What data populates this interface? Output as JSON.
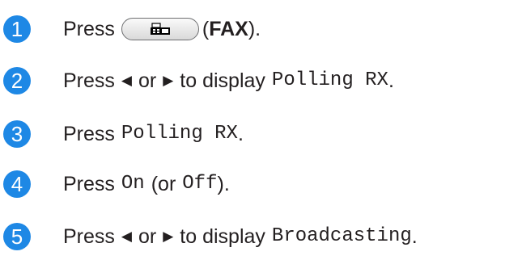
{
  "accent_color": "#1e88e5",
  "steps": [
    {
      "number": "1",
      "press": "Press",
      "open_paren": "(",
      "fax_label": "FAX",
      "close": ")."
    },
    {
      "number": "2",
      "press": "Press",
      "left_arrow": "◀",
      "or": "or",
      "right_arrow": "▶",
      "to_display": "to display",
      "lcd_text": "Polling RX",
      "period": "."
    },
    {
      "number": "3",
      "press": "Press",
      "lcd_text": "Polling RX",
      "period": "."
    },
    {
      "number": "4",
      "press": "Press",
      "lcd_on": "On",
      "open": "(or",
      "lcd_off": "Off",
      "close": ")."
    },
    {
      "number": "5",
      "press": "Press",
      "left_arrow": "◀",
      "or": "or",
      "right_arrow": "▶",
      "to_display": "to display",
      "lcd_text": "Broadcasting",
      "period": "."
    }
  ],
  "fax_key_icon": "fax-machine-icon"
}
